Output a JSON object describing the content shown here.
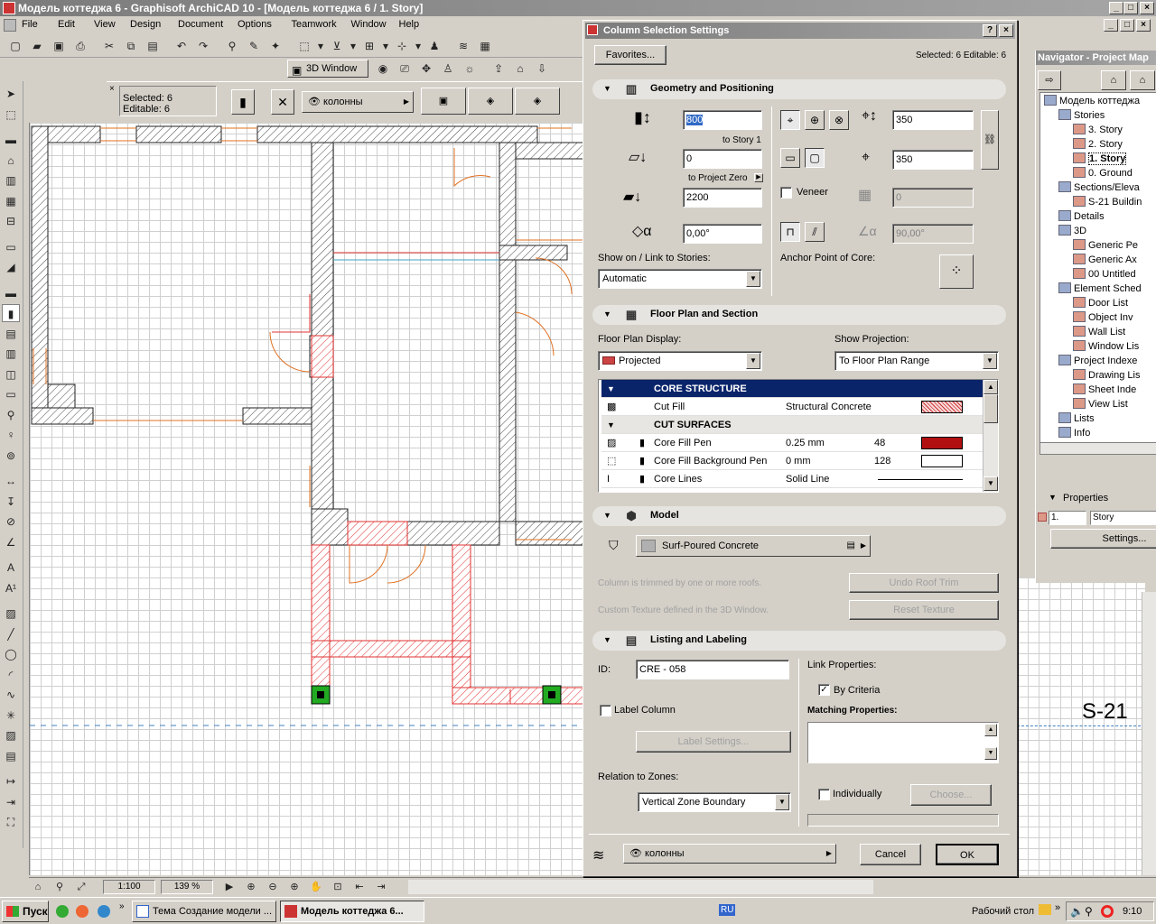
{
  "app": {
    "title": "Модель коттеджа 6 - Graphisoft ArchiCAD 10 - [Модель коттеджа 6 / 1. Story]",
    "menu": [
      "File",
      "Edit",
      "View",
      "Design",
      "Document",
      "Options",
      "Teamwork",
      "Window",
      "Help"
    ],
    "toolbar2": {
      "window3d": "3D Window"
    },
    "info_box": {
      "selected": "Selected: 6",
      "editable": "Editable: 6",
      "layer": "колонны"
    },
    "status": {
      "scale": "1:100",
      "zoom": "139 %"
    }
  },
  "dialog": {
    "title": "Column Selection Settings",
    "favorites": "Favorites...",
    "selected_info": "Selected: 6 Editable: 6",
    "geometry": {
      "header": "Geometry and Positioning",
      "height": "800",
      "to_story": "to Story 1",
      "bottom_offset": "0",
      "to_project_zero": "to Project Zero",
      "elevation": "2200",
      "angle": "0,00°",
      "width_x": "350",
      "width_y": "350",
      "veneer_label": "Veneer",
      "veneer_value": "0",
      "slant_angle": "90,00°",
      "show_on_label": "Show on / Link to Stories:",
      "show_on_value": "Automatic",
      "anchor_label": "Anchor Point of Core:"
    },
    "floor_plan": {
      "header": "Floor Plan and Section",
      "display_label": "Floor Plan Display:",
      "display_value": "Projected",
      "projection_label": "Show Projection:",
      "projection_value": "To Floor Plan Range",
      "rows": [
        {
          "name": "CORE STRUCTURE",
          "value": "",
          "num": "",
          "heading": true
        },
        {
          "name": "Cut Fill",
          "value": "Structural Concrete",
          "num": "",
          "heading": false
        },
        {
          "name": "CUT SURFACES",
          "value": "",
          "num": "",
          "heading": true
        },
        {
          "name": "Core Fill Pen",
          "value": "0.25 mm",
          "num": "48",
          "heading": false
        },
        {
          "name": "Core Fill Background Pen",
          "value": "0 mm",
          "num": "128",
          "heading": false
        },
        {
          "name": "Core Lines",
          "value": "Solid Line",
          "num": "",
          "heading": false
        }
      ]
    },
    "model": {
      "header": "Model",
      "material": "Surf-Poured Concrete",
      "trim_note": "Column is trimmed by one or more roofs.",
      "undo_roof_trim": "Undo Roof Trim",
      "texture_note": "Custom Texture defined in the 3D Window.",
      "reset_texture": "Reset Texture"
    },
    "listing": {
      "header": "Listing and Labeling",
      "id_label": "ID:",
      "id_value": "CRE - 058",
      "label_column": "Label Column",
      "label_settings": "Label Settings...",
      "relation_label": "Relation to Zones:",
      "relation_value": "Vertical Zone Boundary",
      "link_props": "Link Properties:",
      "by_criteria": "By Criteria",
      "matching": "Matching Properties:",
      "individually": "Individually",
      "choose": "Choose..."
    },
    "footer": {
      "layer": "колонны",
      "cancel": "Cancel",
      "ok": "OK"
    }
  },
  "navigator": {
    "title": "Navigator - Project Map",
    "items": [
      {
        "label": "Модель коттеджа",
        "indent": 0,
        "bold": false
      },
      {
        "label": "Stories",
        "indent": 1,
        "bold": false
      },
      {
        "label": "3. Story",
        "indent": 2,
        "bold": false
      },
      {
        "label": "2. Story",
        "indent": 2,
        "bold": false
      },
      {
        "label": "1. Story",
        "indent": 2,
        "bold": true
      },
      {
        "label": "0. Ground",
        "indent": 2,
        "bold": false
      },
      {
        "label": "Sections/Eleva",
        "indent": 1,
        "bold": false
      },
      {
        "label": "S-21 Buildin",
        "indent": 2,
        "bold": false
      },
      {
        "label": "Details",
        "indent": 1,
        "bold": false
      },
      {
        "label": "3D",
        "indent": 1,
        "bold": false
      },
      {
        "label": "Generic Pe",
        "indent": 2,
        "bold": false
      },
      {
        "label": "Generic Ax",
        "indent": 2,
        "bold": false
      },
      {
        "label": "00 Untitled",
        "indent": 2,
        "bold": false
      },
      {
        "label": "Element Sched",
        "indent": 1,
        "bold": false
      },
      {
        "label": "Door List",
        "indent": 2,
        "bold": false
      },
      {
        "label": "Object Inv",
        "indent": 2,
        "bold": false
      },
      {
        "label": "Wall List",
        "indent": 2,
        "bold": false
      },
      {
        "label": "Window Lis",
        "indent": 2,
        "bold": false
      },
      {
        "label": "Project Indexe",
        "indent": 1,
        "bold": false
      },
      {
        "label": "Drawing Lis",
        "indent": 2,
        "bold": false
      },
      {
        "label": "Sheet Inde",
        "indent": 2,
        "bold": false
      },
      {
        "label": "View List",
        "indent": 2,
        "bold": false
      },
      {
        "label": "Lists",
        "indent": 1,
        "bold": false
      },
      {
        "label": "Info",
        "indent": 1,
        "bold": false
      }
    ],
    "properties": "Properties",
    "prop_num": "1.",
    "prop_name": "Story",
    "settings": "Settings..."
  },
  "plan": {
    "section_marker": "S-21"
  },
  "taskbar": {
    "start": "Пуск",
    "tasks": [
      "Тема Создание модели ...",
      "Модель коттеджа 6..."
    ],
    "lang": "RU",
    "desktop": "Рабочий стол",
    "clock": "9:10"
  }
}
